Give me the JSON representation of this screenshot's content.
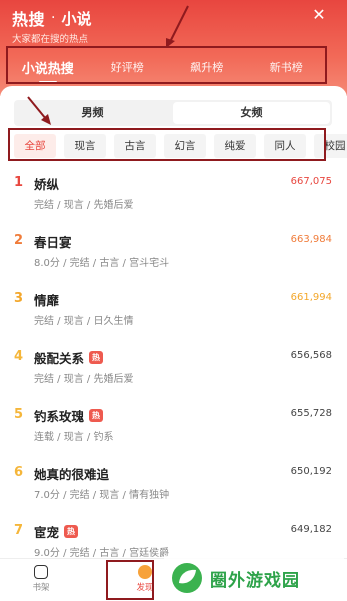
{
  "header": {
    "brand": "热搜",
    "dot": "·",
    "title": "小说",
    "tagline": "大家都在搜的热点",
    "close_icon": "close-icon"
  },
  "tabs": [
    {
      "label": "小说热搜",
      "active": true
    },
    {
      "label": "好评榜",
      "active": false
    },
    {
      "label": "飙升榜",
      "active": false
    },
    {
      "label": "新书榜",
      "active": false
    }
  ],
  "gender": [
    {
      "label": "男频",
      "selected": false
    },
    {
      "label": "女频",
      "selected": true
    }
  ],
  "categories": [
    {
      "label": "全部",
      "selected": true
    },
    {
      "label": "现言",
      "selected": false
    },
    {
      "label": "古言",
      "selected": false
    },
    {
      "label": "幻言",
      "selected": false
    },
    {
      "label": "纯爱",
      "selected": false
    },
    {
      "label": "同人",
      "selected": false
    },
    {
      "label": "校园",
      "selected": false
    }
  ],
  "books": [
    {
      "rank": "1",
      "title": "娇纵",
      "hot": false,
      "meta": "完结 / 现言 / 先婚后爱",
      "count": "667,075",
      "rank_color": "#e8473f",
      "count_color": "#e8473f"
    },
    {
      "rank": "2",
      "title": "春日宴",
      "hot": false,
      "meta": "8.0分 / 完结 / 古言 / 宫斗宅斗",
      "count": "663,984",
      "rank_color": "#f07c3a",
      "count_color": "#f07c3a"
    },
    {
      "rank": "3",
      "title": "情靡",
      "hot": false,
      "meta": "完结 / 现言 / 日久生情",
      "count": "661,994",
      "rank_color": "#f3a72b",
      "count_color": "#f3a72b"
    },
    {
      "rank": "4",
      "title": "般配关系",
      "hot": true,
      "meta": "完结 / 现言 / 先婚后爱",
      "count": "656,568",
      "rank_color": "#f5b63a",
      "count_color": "#444444"
    },
    {
      "rank": "5",
      "title": "钓系玫瑰",
      "hot": true,
      "meta": "连载 / 现言 / 钓系",
      "count": "655,728",
      "rank_color": "#f5b63a",
      "count_color": "#444444"
    },
    {
      "rank": "6",
      "title": "她真的很难追",
      "hot": false,
      "meta": "7.0分 / 完结 / 现言 / 情有独钟",
      "count": "650,192",
      "rank_color": "#f5b63a",
      "count_color": "#444444"
    },
    {
      "rank": "7",
      "title": "宦宠",
      "hot": true,
      "meta": "9.0分 / 完结 / 古言 / 宫廷侯爵",
      "count": "649,182",
      "rank_color": "#f5b63a",
      "count_color": "#444444"
    }
  ],
  "hot_badge": "热",
  "bottom_nav": [
    {
      "label": "书架",
      "icon": "bookshelf-icon"
    },
    {
      "label": "发现",
      "icon": "discover-icon"
    }
  ],
  "watermark": {
    "text": "圈外游戏园",
    "logo_icon": "leaf-logo-icon"
  },
  "colors": {
    "accent": "#e8473f",
    "annotation": "#8f1a1e"
  }
}
